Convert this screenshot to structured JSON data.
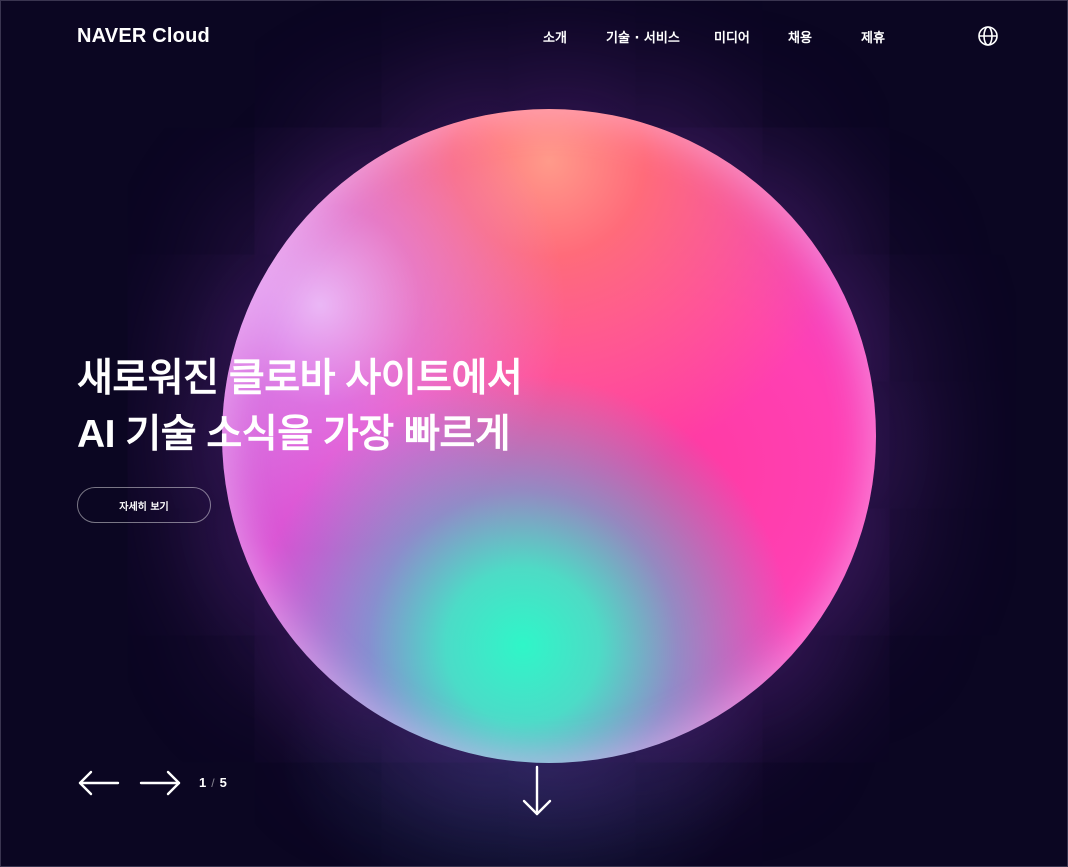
{
  "header": {
    "logo": "NAVER Cloud",
    "nav": [
      {
        "label": "소개"
      },
      {
        "label": "기술 · 서비스"
      },
      {
        "label": "미디어"
      },
      {
        "label": "채용"
      },
      {
        "label": "제휴"
      }
    ],
    "language_icon": "globe-icon"
  },
  "hero": {
    "headline_line1": "새로워진 클로바 사이트에서",
    "headline_line2": "AI 기술 소식을 가장 빠르게",
    "cta_label": "자세히 보기"
  },
  "pagination": {
    "current": "1",
    "separator": "/",
    "total": "5",
    "prev_icon": "arrow-left-icon",
    "next_icon": "arrow-right-icon"
  },
  "scroll_icon": "arrow-down-icon",
  "colors": {
    "background": "#0b0622",
    "text": "#ffffff",
    "orb_pink": "#ff40b4",
    "orb_coral": "#ff6b7a",
    "orb_mint": "#2ff6c8"
  }
}
